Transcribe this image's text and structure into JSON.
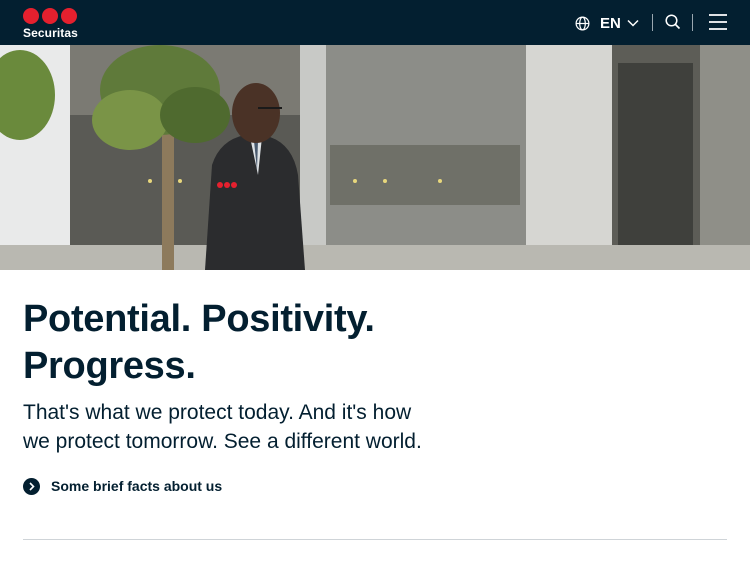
{
  "header": {
    "brand": "Securitas",
    "language": "EN",
    "icons": {
      "language": "globe-icon",
      "language_chevron": "chevron-down-icon",
      "search": "search-icon",
      "menu": "hamburger-menu-icon"
    },
    "colors": {
      "background": "#031f30",
      "brand_red": "#e5202e"
    }
  },
  "hero": {
    "icon": "photo"
  },
  "main": {
    "headline_line1": "Potential. Positivity.",
    "headline_line2": "Progress.",
    "subtext_line1": "That's what we protect today. And it's how",
    "subtext_line2": "we protect tomorrow. See a different world.",
    "facts_link": "Some brief facts about us"
  }
}
